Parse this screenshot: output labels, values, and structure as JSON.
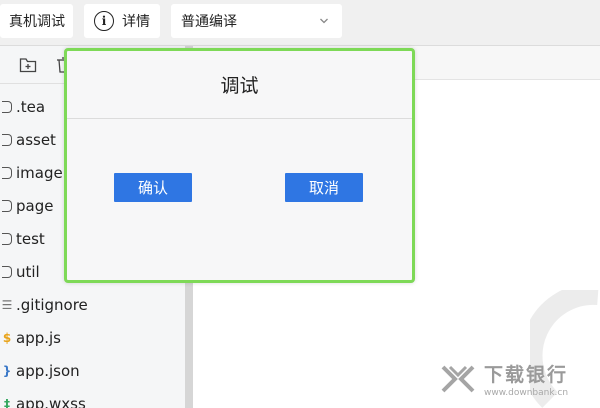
{
  "toolbar": {
    "real_device_label": "真机调试",
    "detail_label": "详情",
    "compile_mode": "普通编译"
  },
  "explorer": {
    "files": [
      {
        "name": ".tea",
        "type": "folder"
      },
      {
        "name": "asset",
        "type": "folder"
      },
      {
        "name": "image",
        "type": "folder"
      },
      {
        "name": "page",
        "type": "folder"
      },
      {
        "name": "test",
        "type": "folder"
      },
      {
        "name": "util",
        "type": "folder"
      },
      {
        "name": ".gitignore",
        "type": "text"
      },
      {
        "name": "app.js",
        "type": "js"
      },
      {
        "name": "app.json",
        "type": "json"
      },
      {
        "name": "app.wxss",
        "type": "wxss"
      }
    ]
  },
  "dialog": {
    "title": "调试",
    "confirm_label": "确认",
    "cancel_label": "取消"
  },
  "colors": {
    "accent": "#2f76e3",
    "dialog_border": "#7ed957"
  },
  "watermark": {
    "brand": "下载银行",
    "url": "www.downbank.cn"
  }
}
